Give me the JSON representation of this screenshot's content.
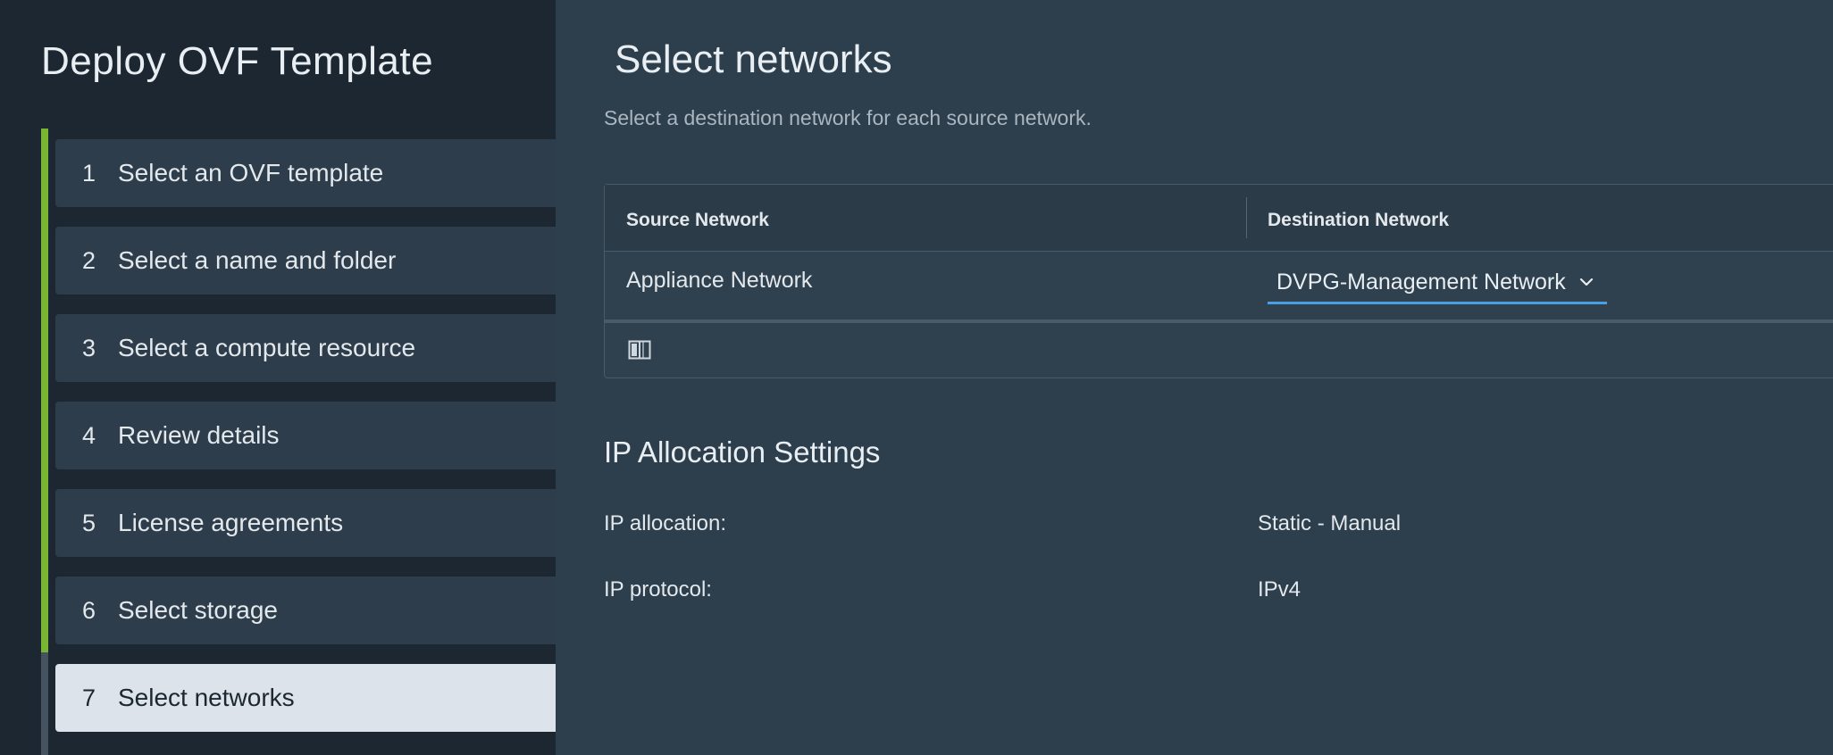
{
  "wizard": {
    "title": "Deploy OVF Template",
    "steps": [
      {
        "number": "1",
        "label": "Select an OVF template"
      },
      {
        "number": "2",
        "label": "Select a name and folder"
      },
      {
        "number": "3",
        "label": "Select a compute resource"
      },
      {
        "number": "4",
        "label": "Review details"
      },
      {
        "number": "5",
        "label": "License agreements"
      },
      {
        "number": "6",
        "label": "Select storage"
      },
      {
        "number": "7",
        "label": "Select networks"
      }
    ],
    "active_step": "7"
  },
  "page": {
    "title": "Select networks",
    "subtitle": "Select a destination network for each source network."
  },
  "network_grid": {
    "columns": [
      "Source Network",
      "Destination Network"
    ],
    "rows": [
      {
        "source": "Appliance Network",
        "destination": "DVPG-Management Network"
      }
    ]
  },
  "ip_allocation": {
    "title": "IP Allocation Settings",
    "items": [
      {
        "label": "IP allocation:",
        "value": "Static - Manual"
      },
      {
        "label": "IP protocol:",
        "value": "IPv4"
      }
    ]
  },
  "colors": {
    "progress_done": "#78b533",
    "select_underline": "#4a9ee4",
    "sidebar_bg": "#1c2731",
    "main_bg": "#2d3e4c",
    "active_step_bg": "#dce3ea"
  }
}
